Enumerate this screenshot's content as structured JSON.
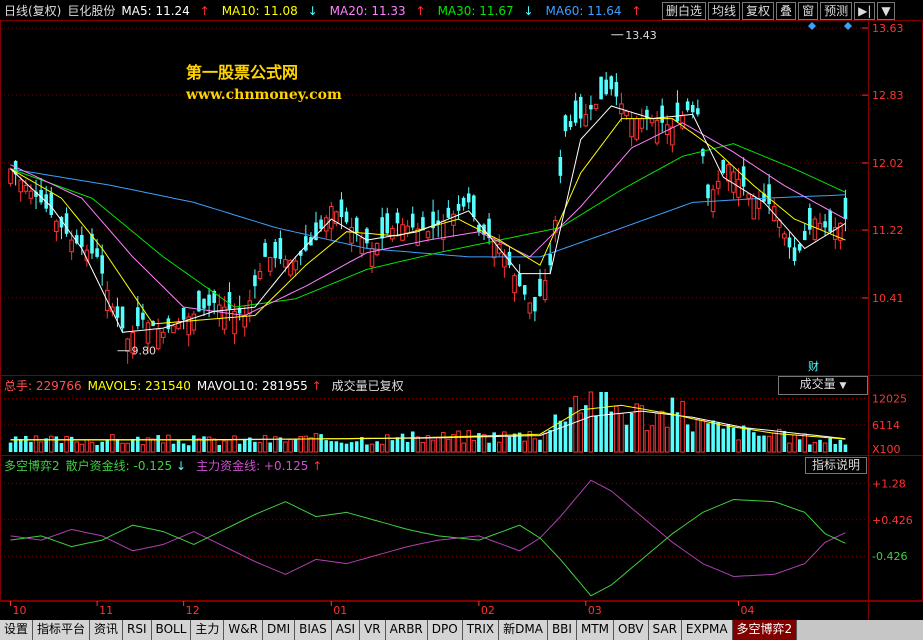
{
  "header": {
    "period": "日线(复权)",
    "stock": "巨化股份",
    "ma5": "MA5: 11.24",
    "ma10": "MA10: 11.08",
    "ma20": "MA20: 11.33",
    "ma30": "MA30: 11.67",
    "ma60": "MA60: 11.64",
    "up_arrow": "↑",
    "down_arrow": "↓"
  },
  "toolbar": {
    "buttons": [
      "删白选",
      "均线",
      "复权",
      "叠",
      "窗",
      "预测"
    ],
    "nav_icon": "play-arrow-icon",
    "down_icon": "triangle-down-icon"
  },
  "watermark": {
    "line1": "第一股票公式网",
    "line2": "www.chnmoney.com"
  },
  "colors": {
    "up": "#ff3232",
    "down": "#54ffff",
    "ma5": "#ffffff",
    "ma10": "#ffff00",
    "ma20": "#ff80ff",
    "ma30": "#00e600",
    "ma60": "#3ca0ff",
    "grid": "#800000",
    "retail": "#b040b0",
    "main": "#40d040"
  },
  "volume": {
    "total": "总手: 229766",
    "mavol5": "MAVOL5: 231540",
    "mavol10": "MAVOL10: 281955",
    "note": "成交量已复权",
    "button": "成交量"
  },
  "indicator": {
    "name": "多空博弈2",
    "retail": "散户资金线: -0.125",
    "main": "主力资金线: +0.125",
    "button": "指标说明"
  },
  "annotations": {
    "high": "13.43",
    "low": "9.80",
    "cai": "财"
  },
  "tabs": [
    "设置",
    "指标平台",
    "资讯",
    "RSI",
    "BOLL",
    "主力",
    "W&R",
    "DMI",
    "BIAS",
    "ASI",
    "VR",
    "ARBR",
    "DPO",
    "TRIX",
    "新DMA",
    "BBI",
    "MTM",
    "OBV",
    "SAR",
    "EXPMA",
    "多空博弈2"
  ],
  "active_tab": "多空博弈2",
  "chart_data": [
    {
      "type": "candlestick",
      "name": "price",
      "y_ticks": [
        10.41,
        11.22,
        12.02,
        12.83,
        13.63
      ],
      "ylim": [
        9.55,
        13.75
      ],
      "x_labels": [
        "10",
        "11",
        "12",
        "01",
        "02",
        "03",
        "04"
      ],
      "x_label_index": [
        0,
        17,
        34,
        63,
        92,
        113,
        143
      ],
      "n": 165,
      "anchors_close": [
        [
          0,
          11.95
        ],
        [
          6,
          11.55
        ],
        [
          12,
          11.1
        ],
        [
          17,
          10.9
        ],
        [
          20,
          10.3
        ],
        [
          23,
          9.92
        ],
        [
          26,
          10.15
        ],
        [
          30,
          10.0
        ],
        [
          34,
          10.15
        ],
        [
          40,
          10.35
        ],
        [
          46,
          10.2
        ],
        [
          50,
          10.9
        ],
        [
          56,
          10.85
        ],
        [
          60,
          11.1
        ],
        [
          63,
          11.5
        ],
        [
          67,
          11.25
        ],
        [
          71,
          11.0
        ],
        [
          76,
          11.3
        ],
        [
          82,
          11.2
        ],
        [
          88,
          11.45
        ],
        [
          90,
          11.55
        ],
        [
          92,
          11.2
        ],
        [
          96,
          11.05
        ],
        [
          100,
          10.55
        ],
        [
          103,
          10.25
        ],
        [
          106,
          10.8
        ],
        [
          109,
          12.4
        ],
        [
          113,
          12.6
        ],
        [
          118,
          12.9
        ],
        [
          122,
          12.55
        ],
        [
          126,
          12.55
        ],
        [
          130,
          12.45
        ],
        [
          133,
          12.65
        ],
        [
          135,
          12.6
        ],
        [
          137,
          11.6
        ],
        [
          141,
          12.0
        ],
        [
          145,
          11.65
        ],
        [
          150,
          11.5
        ],
        [
          154,
          10.85
        ],
        [
          158,
          11.35
        ],
        [
          161,
          11.2
        ],
        [
          164,
          11.35
        ]
      ],
      "ma_anchors": {
        "ma5": [
          [
            0,
            11.95
          ],
          [
            8,
            11.5
          ],
          [
            14,
            11.0
          ],
          [
            22,
            10.0
          ],
          [
            30,
            10.05
          ],
          [
            40,
            10.25
          ],
          [
            48,
            10.3
          ],
          [
            56,
            10.9
          ],
          [
            63,
            11.35
          ],
          [
            70,
            11.1
          ],
          [
            80,
            11.2
          ],
          [
            90,
            11.45
          ],
          [
            100,
            10.7
          ],
          [
            106,
            10.7
          ],
          [
            112,
            12.3
          ],
          [
            118,
            12.7
          ],
          [
            126,
            12.55
          ],
          [
            134,
            12.6
          ],
          [
            140,
            11.85
          ],
          [
            148,
            11.55
          ],
          [
            156,
            11.0
          ],
          [
            164,
            11.3
          ]
        ],
        "ma10": [
          [
            0,
            11.95
          ],
          [
            10,
            11.6
          ],
          [
            18,
            11.0
          ],
          [
            28,
            10.1
          ],
          [
            38,
            10.15
          ],
          [
            48,
            10.2
          ],
          [
            58,
            10.8
          ],
          [
            66,
            11.2
          ],
          [
            76,
            11.15
          ],
          [
            88,
            11.35
          ],
          [
            96,
            11.1
          ],
          [
            104,
            10.8
          ],
          [
            112,
            11.9
          ],
          [
            120,
            12.55
          ],
          [
            130,
            12.55
          ],
          [
            138,
            12.2
          ],
          [
            146,
            11.75
          ],
          [
            154,
            11.35
          ],
          [
            164,
            11.1
          ]
        ],
        "ma20": [
          [
            0,
            12.0
          ],
          [
            14,
            11.6
          ],
          [
            24,
            10.9
          ],
          [
            34,
            10.3
          ],
          [
            46,
            10.2
          ],
          [
            58,
            10.55
          ],
          [
            70,
            10.95
          ],
          [
            82,
            11.1
          ],
          [
            92,
            11.2
          ],
          [
            102,
            10.9
          ],
          [
            112,
            11.5
          ],
          [
            122,
            12.2
          ],
          [
            132,
            12.5
          ],
          [
            142,
            12.15
          ],
          [
            152,
            11.75
          ],
          [
            164,
            11.35
          ]
        ],
        "ma30": [
          [
            0,
            11.95
          ],
          [
            16,
            11.6
          ],
          [
            30,
            10.9
          ],
          [
            44,
            10.3
          ],
          [
            56,
            10.4
          ],
          [
            70,
            10.75
          ],
          [
            84,
            10.95
          ],
          [
            96,
            11.1
          ],
          [
            108,
            11.25
          ],
          [
            120,
            11.7
          ],
          [
            132,
            12.1
          ],
          [
            142,
            12.25
          ],
          [
            154,
            11.95
          ],
          [
            164,
            11.67
          ]
        ],
        "ma60": [
          [
            0,
            11.95
          ],
          [
            20,
            11.75
          ],
          [
            36,
            11.55
          ],
          [
            52,
            11.25
          ],
          [
            70,
            11.0
          ],
          [
            90,
            10.9
          ],
          [
            104,
            10.9
          ],
          [
            118,
            11.2
          ],
          [
            134,
            11.55
          ],
          [
            148,
            11.6
          ],
          [
            164,
            11.64
          ]
        ]
      }
    },
    {
      "type": "bar",
      "name": "volume",
      "y_ticks": [
        6114,
        12025
      ],
      "y_unit": "X100",
      "ylim": [
        0,
        13500
      ],
      "anchors": [
        [
          0,
          2500
        ],
        [
          20,
          2800
        ],
        [
          40,
          2600
        ],
        [
          60,
          2900
        ],
        [
          80,
          3200
        ],
        [
          100,
          3800
        ],
        [
          106,
          5000
        ],
        [
          109,
          11500
        ],
        [
          113,
          13000
        ],
        [
          118,
          10500
        ],
        [
          126,
          8000
        ],
        [
          132,
          9000
        ],
        [
          136,
          6000
        ],
        [
          144,
          4500
        ],
        [
          154,
          3200
        ],
        [
          164,
          2400
        ]
      ],
      "mavol_anchors": {
        "mavol5": [
          [
            0,
            2700
          ],
          [
            40,
            2700
          ],
          [
            80,
            3200
          ],
          [
            104,
            4000
          ],
          [
            112,
            9500
          ],
          [
            120,
            10500
          ],
          [
            130,
            8500
          ],
          [
            140,
            6000
          ],
          [
            150,
            4200
          ],
          [
            164,
            2900
          ]
        ],
        "mavol10": [
          [
            0,
            2800
          ],
          [
            40,
            2800
          ],
          [
            80,
            3100
          ],
          [
            104,
            3700
          ],
          [
            114,
            8000
          ],
          [
            124,
            9200
          ],
          [
            134,
            7800
          ],
          [
            144,
            5500
          ],
          [
            164,
            3000
          ]
        ]
      }
    },
    {
      "type": "line",
      "name": "多空博弈2",
      "y_ticks": [
        1.28,
        0.426,
        -0.426
      ],
      "ylim": [
        -1.45,
        1.45
      ],
      "retail_anchors": [
        [
          0,
          -0.05
        ],
        [
          6,
          0.05
        ],
        [
          12,
          -0.2
        ],
        [
          18,
          -0.05
        ],
        [
          24,
          0.3
        ],
        [
          30,
          0.15
        ],
        [
          36,
          -0.15
        ],
        [
          42,
          0.2
        ],
        [
          48,
          0.55
        ],
        [
          54,
          0.85
        ],
        [
          60,
          0.5
        ],
        [
          66,
          0.6
        ],
        [
          72,
          0.4
        ],
        [
          78,
          0.2
        ],
        [
          84,
          0.05
        ],
        [
          92,
          -0.05
        ],
        [
          100,
          0.3
        ],
        [
          104,
          0.0
        ],
        [
          108,
          -0.5
        ],
        [
          114,
          -1.35
        ],
        [
          118,
          -1.1
        ],
        [
          124,
          -0.5
        ],
        [
          130,
          0.1
        ],
        [
          136,
          0.6
        ],
        [
          142,
          0.9
        ],
        [
          150,
          0.85
        ],
        [
          156,
          0.6
        ],
        [
          160,
          0.1
        ],
        [
          164,
          -0.125
        ]
      ],
      "main_anchors": [
        [
          0,
          0.05
        ],
        [
          6,
          -0.05
        ],
        [
          12,
          0.2
        ],
        [
          18,
          0.05
        ],
        [
          24,
          -0.3
        ],
        [
          30,
          -0.15
        ],
        [
          36,
          0.15
        ],
        [
          42,
          -0.2
        ],
        [
          48,
          -0.55
        ],
        [
          54,
          -0.85
        ],
        [
          60,
          -0.5
        ],
        [
          66,
          -0.6
        ],
        [
          72,
          -0.4
        ],
        [
          78,
          -0.2
        ],
        [
          84,
          -0.05
        ],
        [
          92,
          0.05
        ],
        [
          100,
          -0.3
        ],
        [
          104,
          0.0
        ],
        [
          108,
          0.5
        ],
        [
          114,
          1.35
        ],
        [
          118,
          1.1
        ],
        [
          124,
          0.5
        ],
        [
          130,
          -0.1
        ],
        [
          136,
          -0.6
        ],
        [
          142,
          -0.9
        ],
        [
          150,
          -0.85
        ],
        [
          156,
          -0.6
        ],
        [
          160,
          -0.1
        ],
        [
          164,
          0.125
        ]
      ]
    }
  ]
}
